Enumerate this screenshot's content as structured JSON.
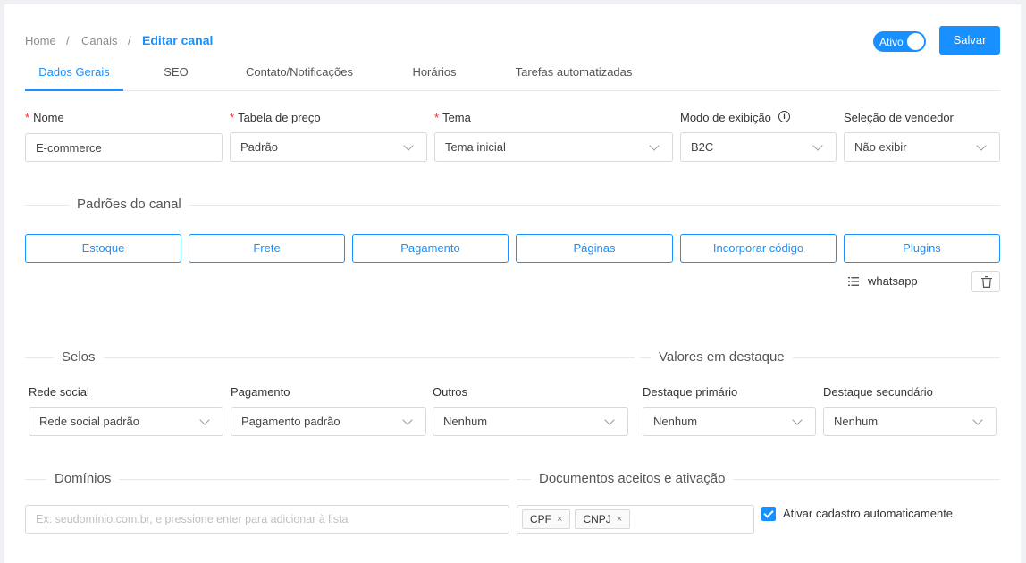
{
  "breadcrumb": {
    "home": "Home",
    "sep1": "/",
    "channels": "Canais",
    "sep2": "/",
    "current": "Editar canal"
  },
  "status_toggle": {
    "label": "Ativo",
    "on": true
  },
  "save_button": "Salvar",
  "tabs": [
    {
      "label": "Dados Gerais",
      "active": true
    },
    {
      "label": "SEO",
      "active": false
    },
    {
      "label": "Contato/Notificações",
      "active": false
    },
    {
      "label": "Horários",
      "active": false
    },
    {
      "label": "Tarefas automatizadas",
      "active": false
    }
  ],
  "general": {
    "name": {
      "label": "Nome",
      "required": true,
      "value": "E-commerce"
    },
    "price_table": {
      "label": "Tabela de preço",
      "required": true,
      "value": "Padrão"
    },
    "theme": {
      "label": "Tema",
      "required": true,
      "value": "Tema inicial"
    },
    "display_mode": {
      "label": "Modo de exibição",
      "value": "B2C",
      "info_icon": "i"
    },
    "seller_selection": {
      "label": "Seleção de vendedor",
      "value": "Não exibir"
    }
  },
  "channel_defaults": {
    "title": "Padrões do canal",
    "buttons": [
      "Estoque",
      "Frete",
      "Pagamento",
      "Páginas",
      "Incorporar código",
      "Plugins"
    ],
    "plugin_item": {
      "label": "whatsapp",
      "icon": "list-icon",
      "action_icon": "trash-icon"
    }
  },
  "seals": {
    "title": "Selos",
    "social": {
      "label": "Rede social",
      "value": "Rede social padrão"
    },
    "payment": {
      "label": "Pagamento",
      "value": "Pagamento padrão"
    },
    "others": {
      "label": "Outros",
      "value": "Nenhum"
    }
  },
  "highlights": {
    "title": "Valores em destaque",
    "primary": {
      "label": "Destaque primário",
      "value": "Nenhum"
    },
    "secondary": {
      "label": "Destaque secundário",
      "value": "Nenhum"
    }
  },
  "domains": {
    "title": "Domínios",
    "placeholder": "Ex: seudomínio.com.br, e pressione enter para adicionar à lista"
  },
  "documents": {
    "title": "Documentos aceitos e ativação",
    "tags": [
      "CPF",
      "CNPJ"
    ],
    "tag_close": "×",
    "auto_activate": {
      "label": "Ativar cadastro automaticamente",
      "checked": true
    }
  },
  "colors": {
    "primary": "#1890ff",
    "required": "#f5222d",
    "border": "#d9d9d9"
  }
}
